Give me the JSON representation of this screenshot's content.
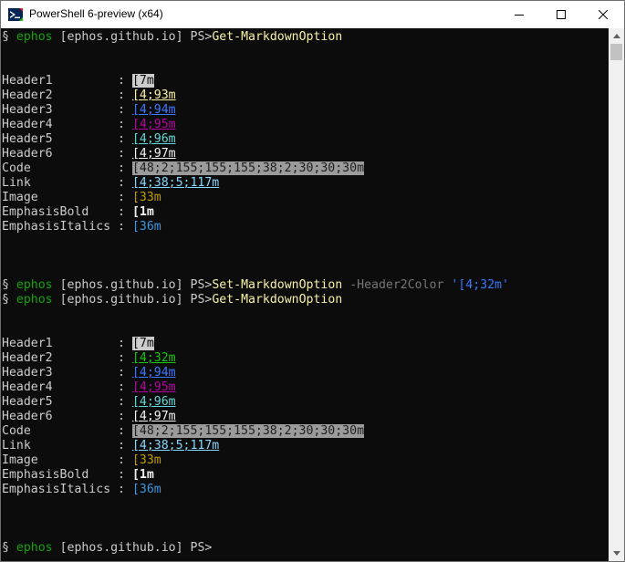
{
  "window": {
    "title": "PowerShell 6-preview (x64)"
  },
  "prompt": {
    "glyph": "§",
    "user": "ephos",
    "location": "[ephos.github.io]",
    "ps": "PS>"
  },
  "commands": {
    "get": "Get-MarkdownOption",
    "set": "Set-MarkdownOption",
    "set_param": "-Header2Color",
    "set_value": "'[4;32m'"
  },
  "labels": {
    "header1": "Header1         :",
    "header2": "Header2         :",
    "header3": "Header3         :",
    "header4": "Header4         :",
    "header5": "Header5         :",
    "header6": "Header6         :",
    "code": "Code            :",
    "link": "Link            :",
    "image": "Image           :",
    "emphasis_bold": "EmphasisBold    :",
    "emphasis_italics": "EmphasisItalics :"
  },
  "output1": {
    "header1": "[7m",
    "header2": "[4;93m",
    "header3": "[4;94m",
    "header4": "[4;95m",
    "header5": "[4;96m",
    "header6": "[4;97m",
    "code": "[48;2;155;155;155;38;2;30;30;30m",
    "link": "[4;38;5;117m",
    "image": "[33m",
    "emphasis_bold": "[1m",
    "emphasis_italics": "[36m"
  },
  "output2": {
    "header1": "[7m",
    "header2": "[4;32m",
    "header3": "[4;94m",
    "header4": "[4;95m",
    "header5": "[4;96m",
    "header6": "[4;97m",
    "code": "[48;2;155;155;155;38;2;30;30;30m",
    "link": "[4;38;5;117m",
    "image": "[33m",
    "emphasis_bold": "[1m",
    "emphasis_italics": "[36m"
  },
  "colors": {
    "terminal_bg": "#0c0c0c",
    "prompt_user": "#13a10e",
    "command": "#f9f1a5",
    "parameter": "#767676",
    "string": "#3b78ff",
    "header1_bg": "#cccccc",
    "header2_yellow": "#f9f1a5",
    "header2_green": "#16c60c",
    "header3_blue": "#3b78ff",
    "header4_magenta": "#b4009e",
    "header5_cyan": "#61d6d6",
    "header6_white": "#f2f2f2",
    "code_bg": "#9b9b9b",
    "code_fg": "#1e1e1e",
    "link": "#87d7ff",
    "image": "#c19c00",
    "emphasis_italics": "#3a96dd"
  }
}
